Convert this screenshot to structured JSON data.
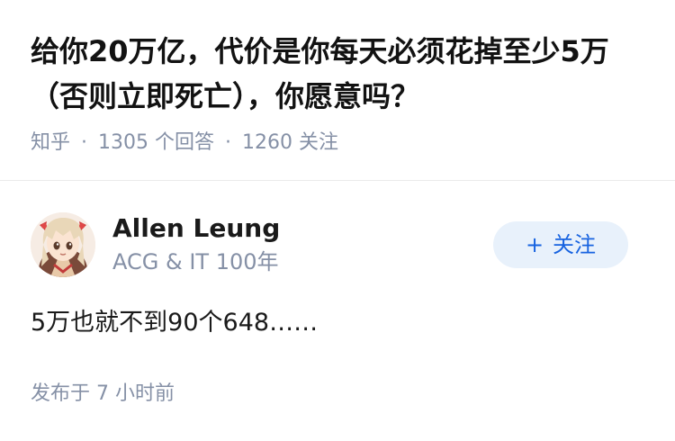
{
  "question": {
    "title": "给你20万亿，代价是你每天必须花掉至少5万（否则立即死亡），你愿意吗？",
    "source": "知乎",
    "separator": "·",
    "answer_count_text": "1305 个回答",
    "follower_count_text": "1260 关注"
  },
  "answer": {
    "author": {
      "name": "Allen Leung",
      "bio": "ACG & IT 100年",
      "avatar_icon": "anime-girl-avatar-icon"
    },
    "follow_button": {
      "plus": "+",
      "label": "关注"
    },
    "content": "5万也就不到90个648……",
    "publish_time": "发布于 7 小时前"
  },
  "colors": {
    "title": "#121212",
    "meta": "#8590a6",
    "follow_bg": "#e8f1fb",
    "follow_text": "#1763e0",
    "divider": "#ebebeb"
  }
}
